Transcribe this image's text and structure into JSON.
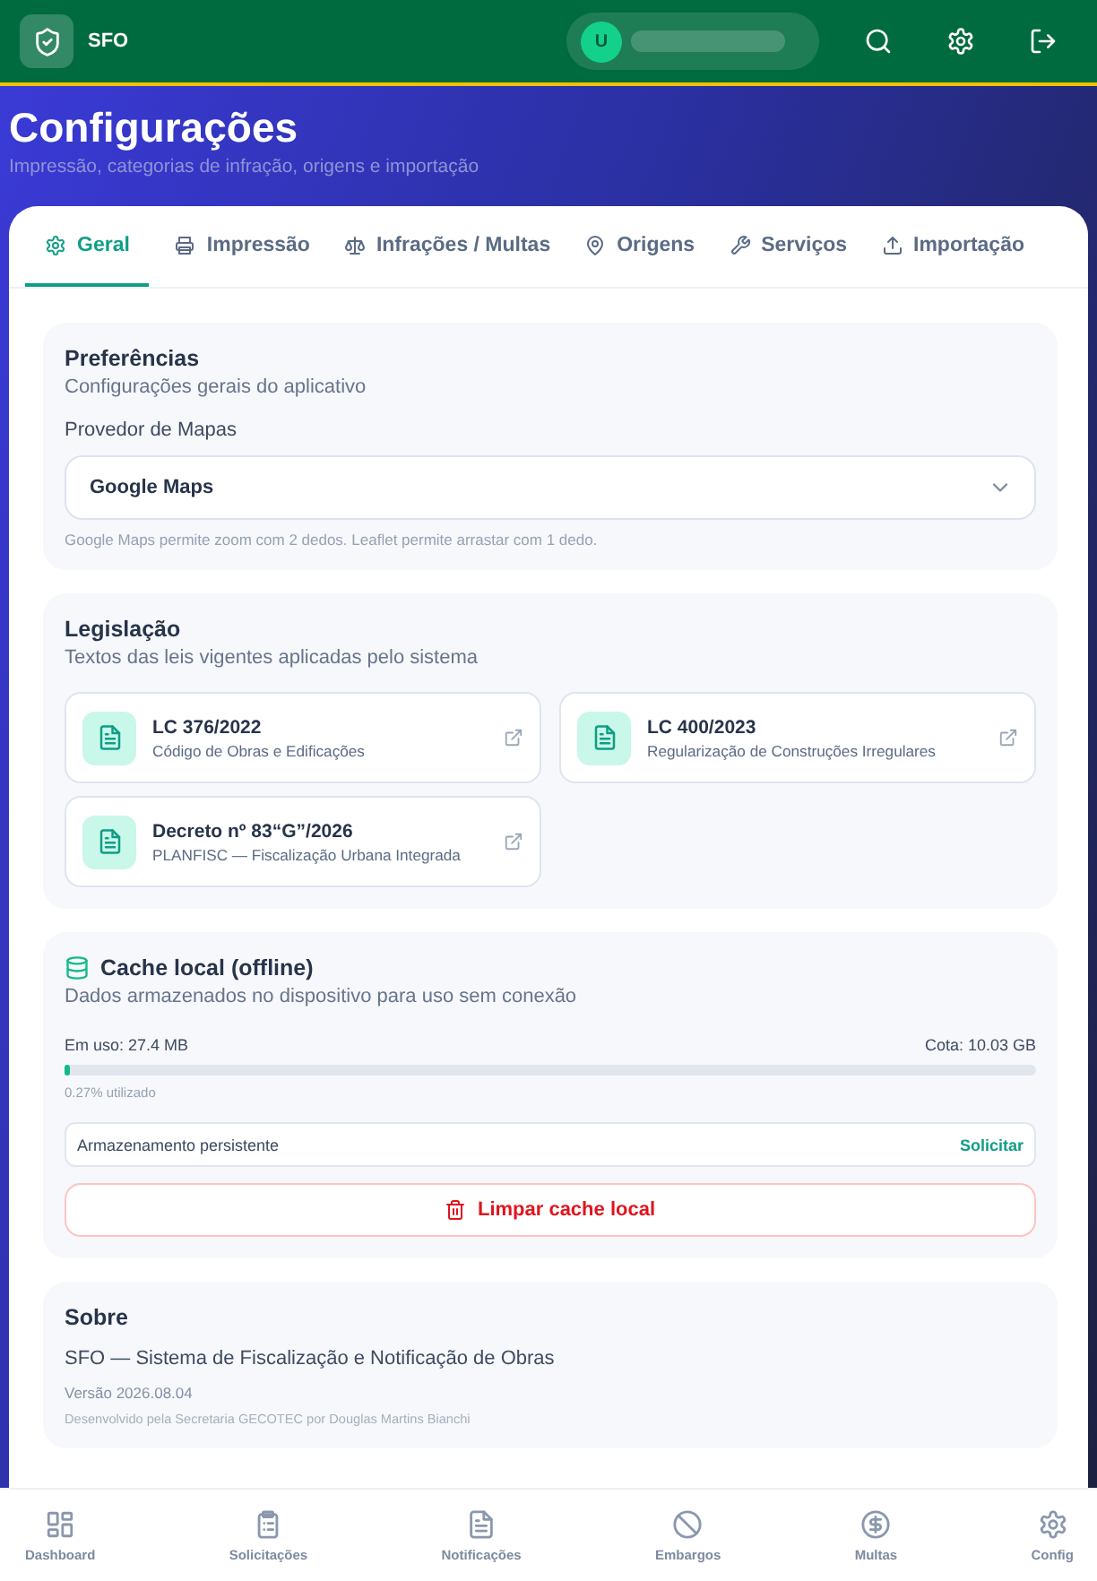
{
  "header": {
    "app_name": "SFO",
    "avatar_initial": "U"
  },
  "page": {
    "title": "Configurações",
    "subtitle": "Impressão, categorias de infração, origens e importação"
  },
  "tabs": [
    {
      "label": "Geral",
      "selected": true
    },
    {
      "label": "Impressão",
      "selected": false
    },
    {
      "label": "Infrações / Multas",
      "selected": false
    },
    {
      "label": "Origens",
      "selected": false
    },
    {
      "label": "Serviços",
      "selected": false
    },
    {
      "label": "Importação",
      "selected": false
    }
  ],
  "preferences": {
    "title": "Preferências",
    "subtitle": "Configurações gerais do aplicativo",
    "field_label": "Provedor de Mapas",
    "value": "Google Maps",
    "hint": "Google Maps permite zoom com 2 dedos. Leaflet permite arrastar com 1 dedo."
  },
  "legislation": {
    "title": "Legislação",
    "subtitle": "Textos das leis vigentes aplicadas pelo sistema",
    "laws": [
      {
        "title": "LC 376/2022",
        "description": "Código de Obras e Edificações"
      },
      {
        "title": "LC 400/2023",
        "description": "Regularização de Construções Irregulares"
      },
      {
        "title": "Decreto nº 83“G”/2026",
        "description": "PLANFISC — Fiscalização Urbana Integrada"
      }
    ]
  },
  "cache": {
    "title": "Cache local (offline)",
    "subtitle": "Dados armazenados no dispositivo para uso sem conexão",
    "used": "Em uso: 27.4 MB",
    "quota": "Cota: 10.03 GB",
    "level": 0.0027,
    "percent": "0.27% utilizado",
    "persistent_label": "Armazenamento persistente",
    "persistent_action": "Solicitar",
    "clear_button": "Limpar cache local"
  },
  "about": {
    "title": "Sobre",
    "system": "SFO — Sistema de Fiscalização e Notificação de Obras",
    "version": "Versão 2026.08.04",
    "credits": "Desenvolvido pela Secretaria GECOTEC por Douglas Martins Bianchi"
  },
  "bottom_nav": [
    {
      "label": "Dashboard"
    },
    {
      "label": "Solicitações"
    },
    {
      "label": "Notificações"
    },
    {
      "label": "Embargos"
    },
    {
      "label": "Multas"
    },
    {
      "label": "Config"
    }
  ]
}
